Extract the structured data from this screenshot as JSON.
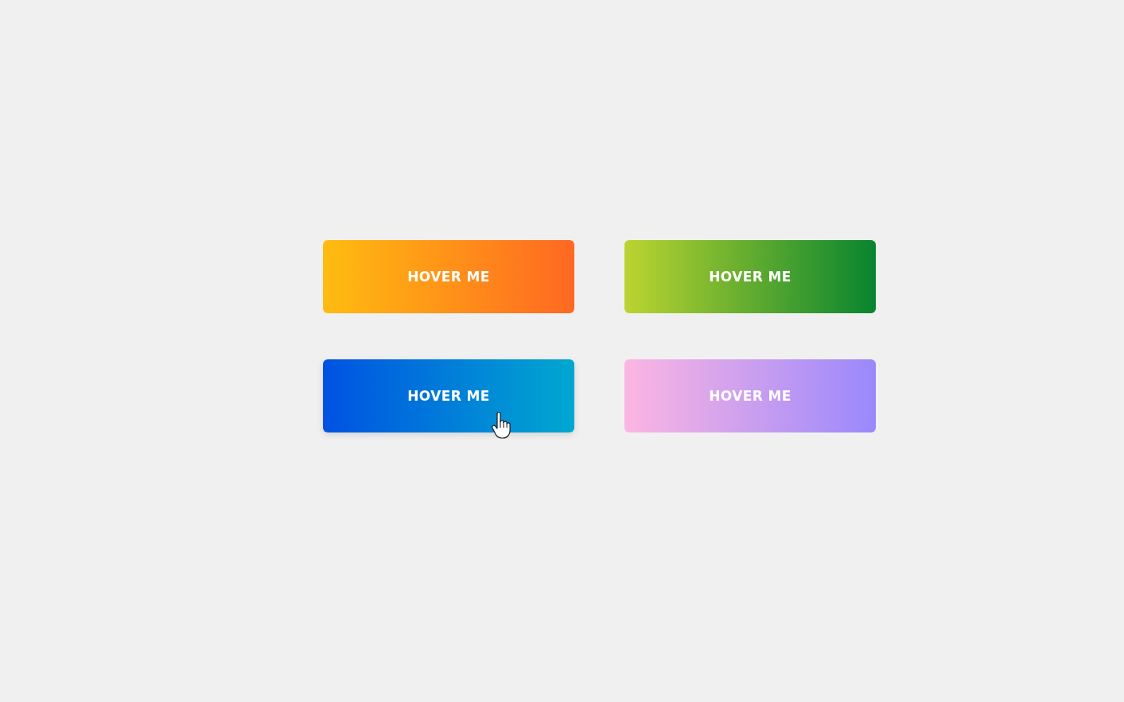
{
  "buttons": [
    {
      "label": "HOVER ME",
      "stops": [
        {
          "color": "#ffbc10"
        },
        {
          "color": "#ff6822"
        }
      ],
      "hovered": false
    },
    {
      "label": "HOVER ME",
      "stops": [
        {
          "color": "#bcd430"
        },
        {
          "color": "#08842f"
        }
      ],
      "hovered": false
    },
    {
      "label": "HOVER ME",
      "stops": [
        {
          "color": "#0052e2"
        },
        {
          "color": "#00a8d0"
        }
      ],
      "hovered": true
    },
    {
      "label": "HOVER ME",
      "stops": [
        {
          "color": "#fcb6e2"
        },
        {
          "color": "#9a88fc"
        }
      ],
      "hovered": false
    }
  ]
}
